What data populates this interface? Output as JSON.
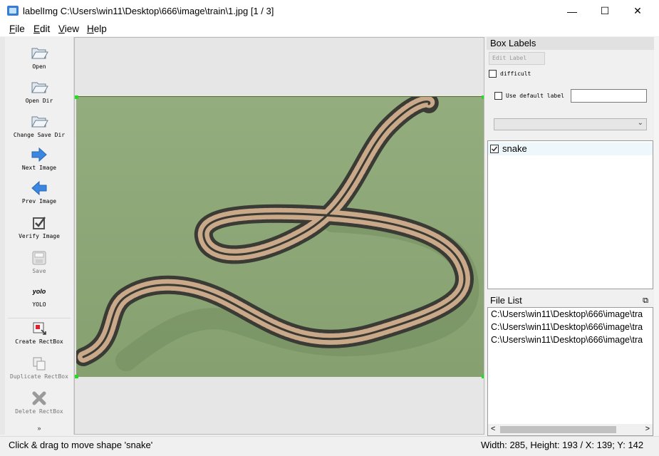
{
  "window": {
    "title": "labelImg C:\\Users\\win11\\Desktop\\666\\image\\train\\1.jpg [1 / 3]",
    "minimize": "—",
    "maximize": "☐",
    "close": "✕"
  },
  "menu": [
    {
      "key": "F",
      "rest": "ile"
    },
    {
      "key": "E",
      "rest": "dit"
    },
    {
      "key": "V",
      "rest": "iew"
    },
    {
      "key": "H",
      "rest": "elp"
    }
  ],
  "toolbar": {
    "open": "Open",
    "open_dir": "Open Dir",
    "change_save_dir": "Change Save Dir",
    "next_image": "Next Image",
    "prev_image": "Prev Image",
    "verify_image": "Verify Image",
    "save": "Save",
    "format_icon_text": "yolo",
    "format": "YOLO",
    "create_rectbox": "Create RectBox",
    "duplicate_rectbox": "Duplicate RectBox",
    "delete_rectbox": "Delete RectBox",
    "more": "»"
  },
  "box_labels": {
    "header": "Box Labels",
    "edit_label": "Edit Label",
    "difficult": "difficult",
    "use_default_label": "Use default label",
    "default_label_value": "",
    "combo_value": "",
    "labels": [
      {
        "name": "snake",
        "checked": true
      }
    ]
  },
  "file_list": {
    "header": "File List",
    "files": [
      "C:\\Users\\win11\\Desktop\\666\\image\\tra",
      "C:\\Users\\win11\\Desktop\\666\\image\\tra",
      "C:\\Users\\win11\\Desktop\\666\\image\\tra"
    ]
  },
  "status": {
    "message": "Click & drag to move shape 'snake'",
    "info": "Width: 285, Height: 193 / X: 139; Y: 142"
  },
  "colors": {
    "canvas_bg": "#e6e6e6",
    "photo_bg": "#8fa779",
    "handle": "#22dd22",
    "arrow_blue": "#3a86e0"
  }
}
